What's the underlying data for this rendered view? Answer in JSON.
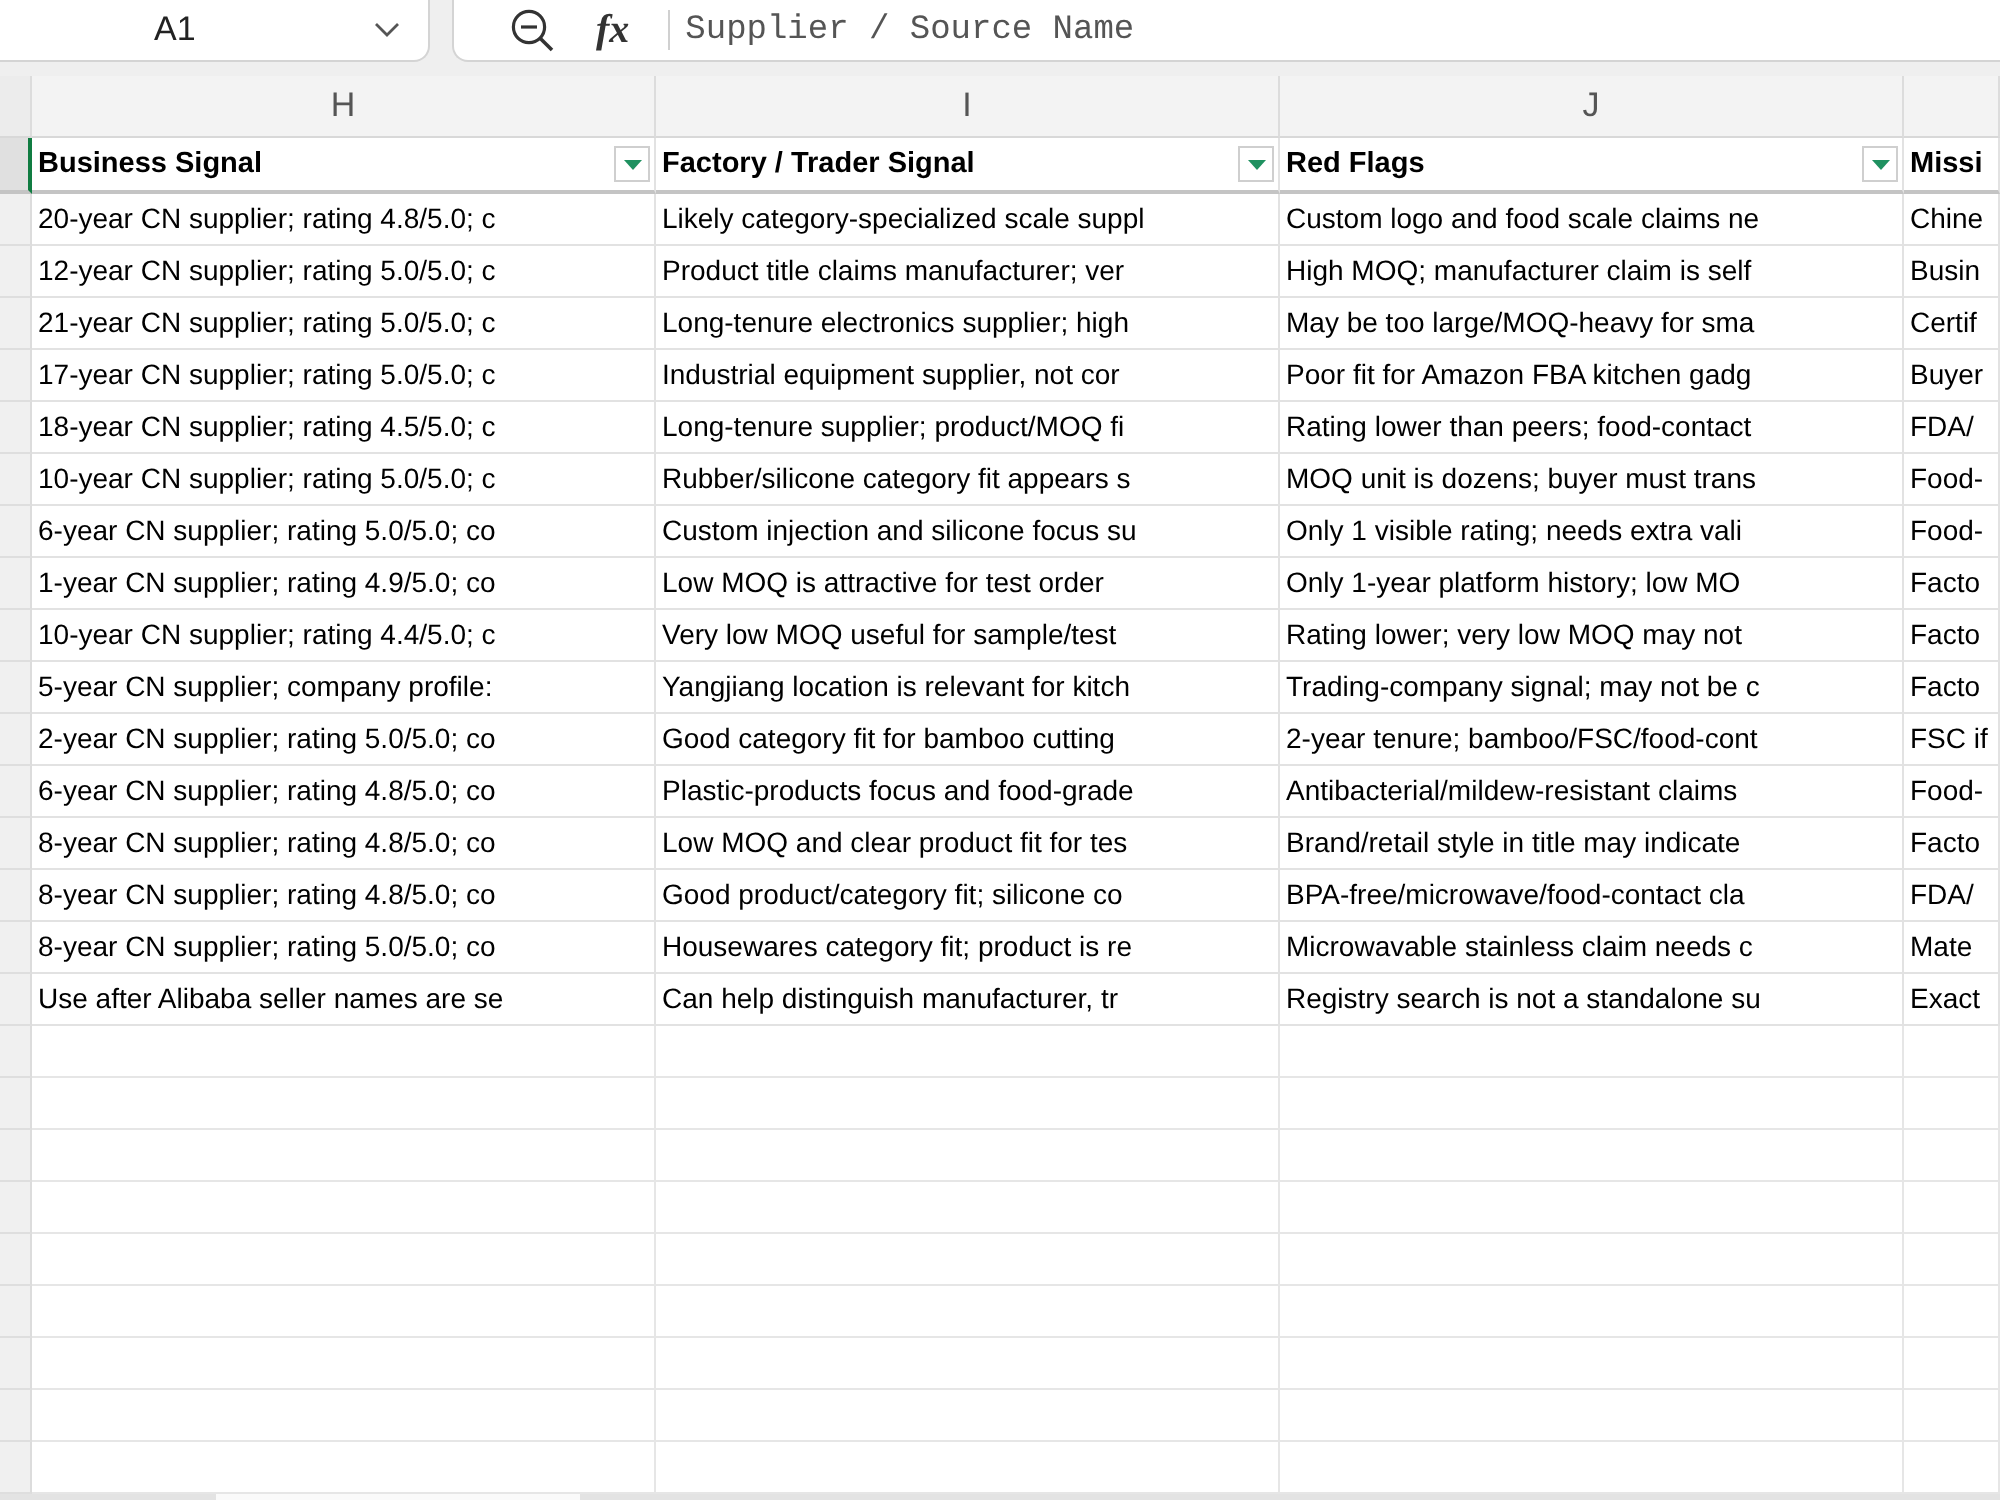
{
  "name_box": {
    "value": "A1"
  },
  "formula_bar": {
    "function_label": "fx",
    "value": "Supplier / Source Name"
  },
  "sheet": {
    "column_letters": [
      "H",
      "I",
      "J"
    ],
    "header_row": {
      "selected": true,
      "cells": [
        {
          "title": "Business Signal",
          "filter": true
        },
        {
          "title": "Factory / Trader Signal",
          "filter": true
        },
        {
          "title": "Red Flags",
          "filter": true
        },
        {
          "title": "Missi",
          "filter": false
        }
      ]
    },
    "rows": [
      {
        "selected": false,
        "cells": [
          "20-year CN supplier; rating 4.8/5.0; c",
          "Likely category-specialized scale suppl",
          "Custom logo and food scale claims ne",
          "Chine"
        ]
      },
      {
        "selected": false,
        "cells": [
          "12-year CN supplier; rating 5.0/5.0; c",
          "Product title claims manufacturer; ver",
          "High MOQ; manufacturer claim is self",
          "Busin"
        ]
      },
      {
        "selected": false,
        "cells": [
          "21-year CN supplier; rating 5.0/5.0; c",
          "Long-tenure electronics supplier; high",
          "May be too large/MOQ-heavy for sma",
          "Certif"
        ]
      },
      {
        "selected": false,
        "cells": [
          "17-year CN supplier; rating 5.0/5.0; c",
          "Industrial equipment supplier, not cor",
          "Poor fit for Amazon FBA kitchen gadg",
          "Buyer"
        ]
      },
      {
        "selected": false,
        "cells": [
          "18-year CN supplier; rating 4.5/5.0; c",
          "Long-tenure supplier; product/MOQ fi",
          "Rating lower than peers; food-contact",
          "FDA/"
        ]
      },
      {
        "selected": false,
        "cells": [
          "10-year CN supplier; rating 5.0/5.0; c",
          "Rubber/silicone category fit appears s",
          "MOQ unit is dozens; buyer must trans",
          "Food-"
        ]
      },
      {
        "selected": false,
        "cells": [
          "6-year CN supplier; rating 5.0/5.0; co",
          "Custom injection and silicone focus su",
          "Only 1 visible rating; needs extra vali",
          "Food-"
        ]
      },
      {
        "selected": false,
        "cells": [
          "1-year CN supplier; rating 4.9/5.0; co",
          "Low MOQ is attractive for test order",
          "Only 1-year platform history; low MO",
          "Facto"
        ]
      },
      {
        "selected": false,
        "cells": [
          "10-year CN supplier; rating 4.4/5.0; c",
          "Very low MOQ useful for sample/test",
          "Rating lower; very low MOQ may not",
          "Facto"
        ]
      },
      {
        "selected": false,
        "cells": [
          "5-year CN supplier; company profile:",
          "Yangjiang location is relevant for kitch",
          "Trading-company signal; may not be c",
          "Facto"
        ]
      },
      {
        "selected": false,
        "cells": [
          "2-year CN supplier; rating 5.0/5.0; co",
          "Good category fit for bamboo cutting",
          "2-year tenure; bamboo/FSC/food-cont",
          "FSC if"
        ]
      },
      {
        "selected": false,
        "cells": [
          "6-year CN supplier; rating 4.8/5.0; co",
          "Plastic-products focus and food-grade",
          "Antibacterial/mildew-resistant claims",
          "Food-"
        ]
      },
      {
        "selected": false,
        "cells": [
          "8-year CN supplier; rating 4.8/5.0; co",
          "Low MOQ and clear product fit for tes",
          "Brand/retail style in title may indicate",
          "Facto"
        ]
      },
      {
        "selected": false,
        "cells": [
          "8-year CN supplier; rating 4.8/5.0; co",
          "Good product/category fit; silicone co",
          "BPA-free/microwave/food-contact cla",
          "FDA/"
        ]
      },
      {
        "selected": false,
        "cells": [
          "8-year CN supplier; rating 5.0/5.0; co",
          "Housewares category fit; product is re",
          "Microwavable stainless claim needs c",
          "Mate"
        ]
      },
      {
        "selected": false,
        "cells": [
          "Use after Alibaba seller names are se",
          "Can help distinguish manufacturer, tr",
          "Registry search is not a standalone su",
          "Exact"
        ]
      }
    ]
  }
}
